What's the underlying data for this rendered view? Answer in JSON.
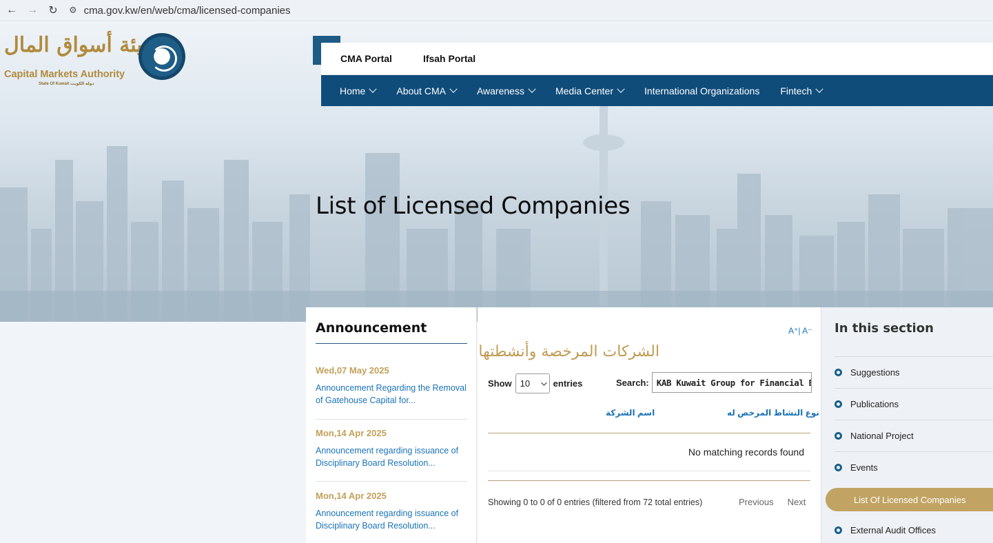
{
  "browser": {
    "url": "cma.gov.kw/en/web/cma/licensed-companies"
  },
  "logo": {
    "arabic": "هيئة أسواق المال",
    "english": "Capital Markets Authority",
    "sub": "State Of Kuwait  دولة الكويت"
  },
  "portals": [
    "CMA Portal",
    "Ifsah Portal"
  ],
  "nav": [
    {
      "label": "Home",
      "dropdown": true
    },
    {
      "label": "About CMA",
      "dropdown": true
    },
    {
      "label": "Awareness",
      "dropdown": true
    },
    {
      "label": "Media Center",
      "dropdown": true
    },
    {
      "label": "International Organizations",
      "dropdown": false
    },
    {
      "label": "Fintech",
      "dropdown": true
    }
  ],
  "page": {
    "title": "List of Licensed Companies"
  },
  "announcement": {
    "title": "Announcement",
    "items": [
      {
        "date": "Wed,07 May 2025",
        "text": "Announcement Regarding the Removal of Gatehouse Capital for..."
      },
      {
        "date": "Mon,14 Apr 2025",
        "text": "Announcement regarding issuance of Disciplinary Board Resolution..."
      },
      {
        "date": "Mon,14 Apr 2025",
        "text": "Announcement regarding issuance of Disciplinary Board Resolution..."
      }
    ]
  },
  "table": {
    "font_size_control": "A⁺| A⁻",
    "arabic_title": "الشركات المرخصة وأنشطتها",
    "show_label": "Show",
    "entries_value": "10",
    "entries_label": "entries",
    "search_label": "Search:",
    "search_value": "KAB Kuwait Group for Financial Brokerage",
    "col_activity": "نوع النشاط المرخص له",
    "col_company": "اسم الشركة",
    "empty_message": "No matching records found",
    "info": "Showing 0 to 0 of 0 entries (filtered from 72 total entries)",
    "prev": "Previous",
    "next": "Next"
  },
  "section": {
    "title": "In this section",
    "items": [
      "Suggestions",
      "Publications",
      "National Project",
      "Events"
    ],
    "active": "List Of Licensed Companies",
    "after": "External Audit Offices"
  },
  "colors": {
    "nav_bg": "#0f4c7a",
    "gold": "#c1a463",
    "link": "#1a73b8"
  }
}
